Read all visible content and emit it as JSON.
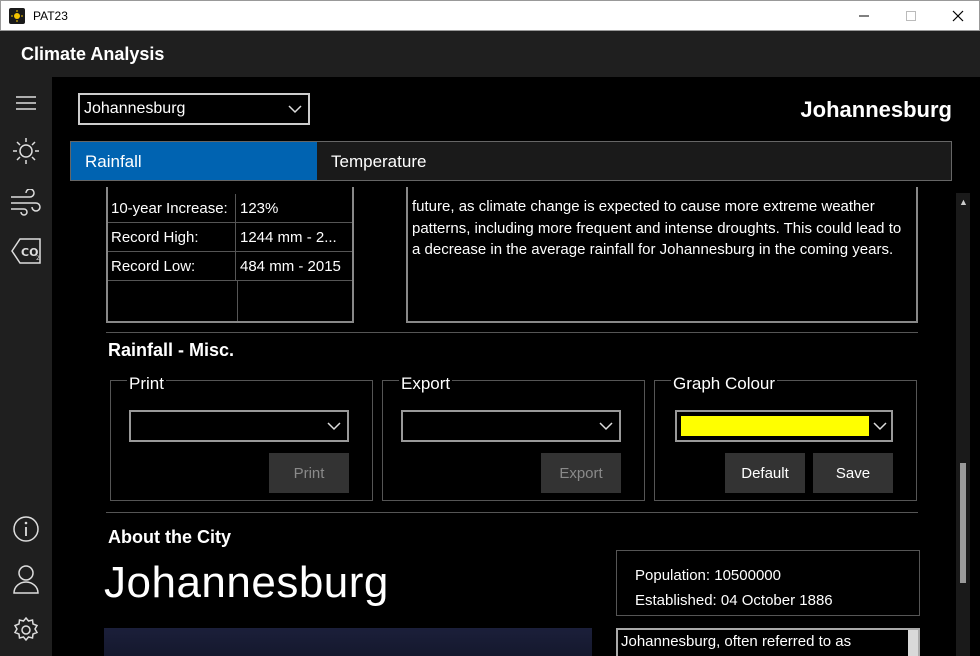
{
  "window": {
    "title": "PAT23"
  },
  "app": {
    "title": "Climate Analysis"
  },
  "rail": {
    "icons": [
      "hamburger-icon",
      "sun-icon",
      "wind-icon",
      "co2-icon",
      "info-icon",
      "user-icon",
      "gear-icon"
    ]
  },
  "topbar": {
    "city_select_value": "Johannesburg",
    "city_heading": "Johannesburg"
  },
  "tabs": [
    {
      "label": "Rainfall",
      "active": true
    },
    {
      "label": "Temperature",
      "active": false
    }
  ],
  "stats": [
    {
      "key": "10-year Increase:",
      "value": "123%"
    },
    {
      "key": "Record High:",
      "value": "1244 mm - 2..."
    },
    {
      "key": "Record Low:",
      "value": "484 mm - 2015"
    }
  ],
  "description": "future, as climate change is expected to cause more extreme weather patterns, including more frequent and intense droughts. This could lead to a decrease in the average rainfall for Johannesburg in the coming years.",
  "misc": {
    "title": "Rainfall - Misc.",
    "print": {
      "title": "Print",
      "button": "Print"
    },
    "export": {
      "title": "Export",
      "button": "Export"
    },
    "graph_colour": {
      "title": "Graph Colour",
      "selected_colour": "#ffff00",
      "default_button": "Default",
      "save_button": "Save"
    }
  },
  "about": {
    "title": "About the City",
    "city_name": "Johannesburg",
    "population": "Population: 10500000",
    "established": "Established: 04 October 1886",
    "description": "Johannesburg, often referred to as"
  },
  "colors": {
    "accent": "#0063b1",
    "background": "#000000",
    "panel": "#1f1f1f"
  }
}
